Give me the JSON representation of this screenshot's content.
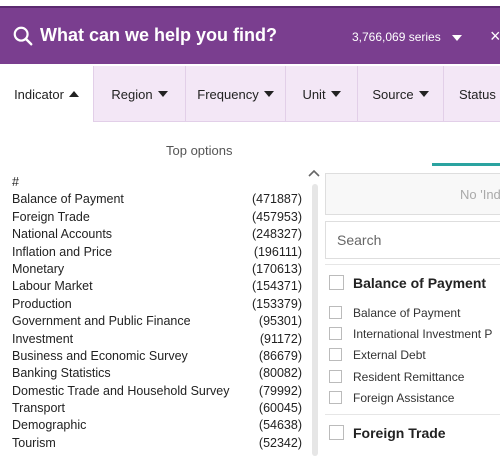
{
  "search": {
    "prompt": "What can we help you find?",
    "series_count": "3,766,069 series",
    "close_glyph": "×"
  },
  "tabs": [
    {
      "label": "Indicator",
      "caret": "up",
      "active": true
    },
    {
      "label": "Region",
      "caret": "down"
    },
    {
      "label": "Frequency",
      "caret": "down"
    },
    {
      "label": "Unit",
      "caret": "down"
    },
    {
      "label": "Source",
      "caret": "down"
    },
    {
      "label": "Status",
      "caret": "down"
    }
  ],
  "top_options": {
    "heading": "Top options",
    "items": [
      {
        "name": "#",
        "count": ""
      },
      {
        "name": "Balance of Payment",
        "count": "(471887)"
      },
      {
        "name": "Foreign Trade",
        "count": "(457953)"
      },
      {
        "name": "National Accounts",
        "count": "(248327)"
      },
      {
        "name": "Inflation and Price",
        "count": "(196111)"
      },
      {
        "name": "Monetary",
        "count": "(170613)"
      },
      {
        "name": "Labour Market",
        "count": "(154371)"
      },
      {
        "name": "Production",
        "count": "(153379)"
      },
      {
        "name": "Government and Public Finance",
        "count": "(95301)"
      },
      {
        "name": "Investment",
        "count": "(91172)"
      },
      {
        "name": "Business and Economic Survey",
        "count": "(86679)"
      },
      {
        "name": "Banking Statistics",
        "count": "(80082)"
      },
      {
        "name": "Domestic Trade and Household Survey",
        "count": "(79992)"
      },
      {
        "name": "Transport",
        "count": "(60045)"
      },
      {
        "name": "Demographic",
        "count": "(54638)"
      },
      {
        "name": "Tourism",
        "count": "(52342)"
      }
    ]
  },
  "panel": {
    "no_indicator_label": "No 'Ind",
    "search_placeholder": "Search",
    "groups": [
      {
        "label": "Balance of Payment",
        "items": [
          "Balance of Payment",
          "International Investment P",
          "External Debt",
          "Resident Remittance",
          "Foreign Assistance"
        ]
      },
      {
        "label": "Foreign Trade",
        "items": []
      }
    ]
  },
  "colors": {
    "brand_purple": "#7a3e8f",
    "tab_bg": "#f3e7f6",
    "accent_teal": "#2aa3a0"
  }
}
